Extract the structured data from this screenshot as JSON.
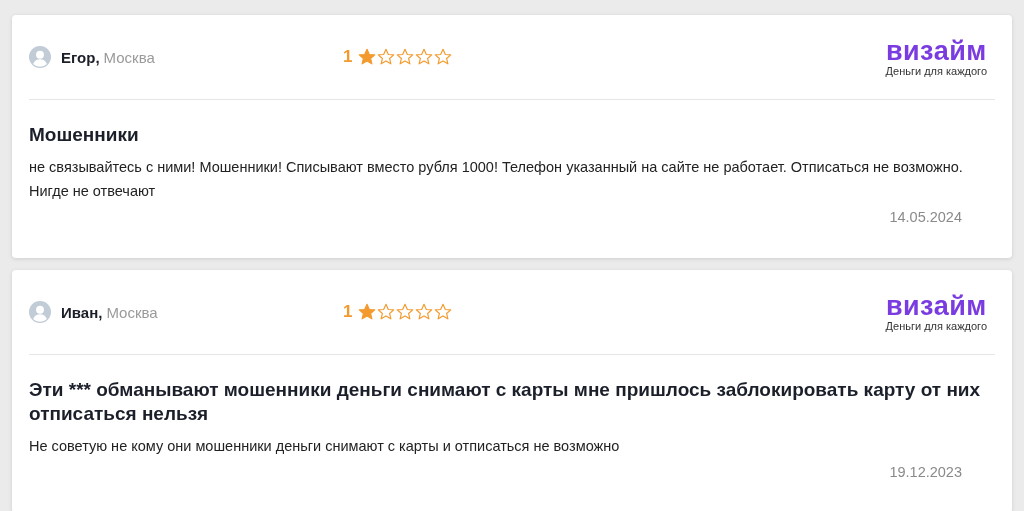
{
  "reviews": [
    {
      "author": "Егор,",
      "city": "Москва",
      "rating": "1",
      "stars": 1,
      "brand": "визайм",
      "slogan": "Деньги для каждого",
      "title": "Мошенники",
      "text": "не связывайтесь с ними! Мошенники! Списывают вместо рубля 1000! Телефон указанный на сайте не работает. Отписаться не возможно. Нигде не отвечают",
      "date": "14.05.2024"
    },
    {
      "author": "Иван,",
      "city": "Москва",
      "rating": "1",
      "stars": 1,
      "brand": "визайм",
      "slogan": "Деньги для каждого",
      "title": "Эти *** обманывают мошенники деньги снимают с карты мне пришлось заблокировать карту от них отписаться нельзя",
      "text": "Не советую не кому они мошенники деньги снимают с карты и отписаться не возможно",
      "date": "19.12.2023"
    }
  ]
}
